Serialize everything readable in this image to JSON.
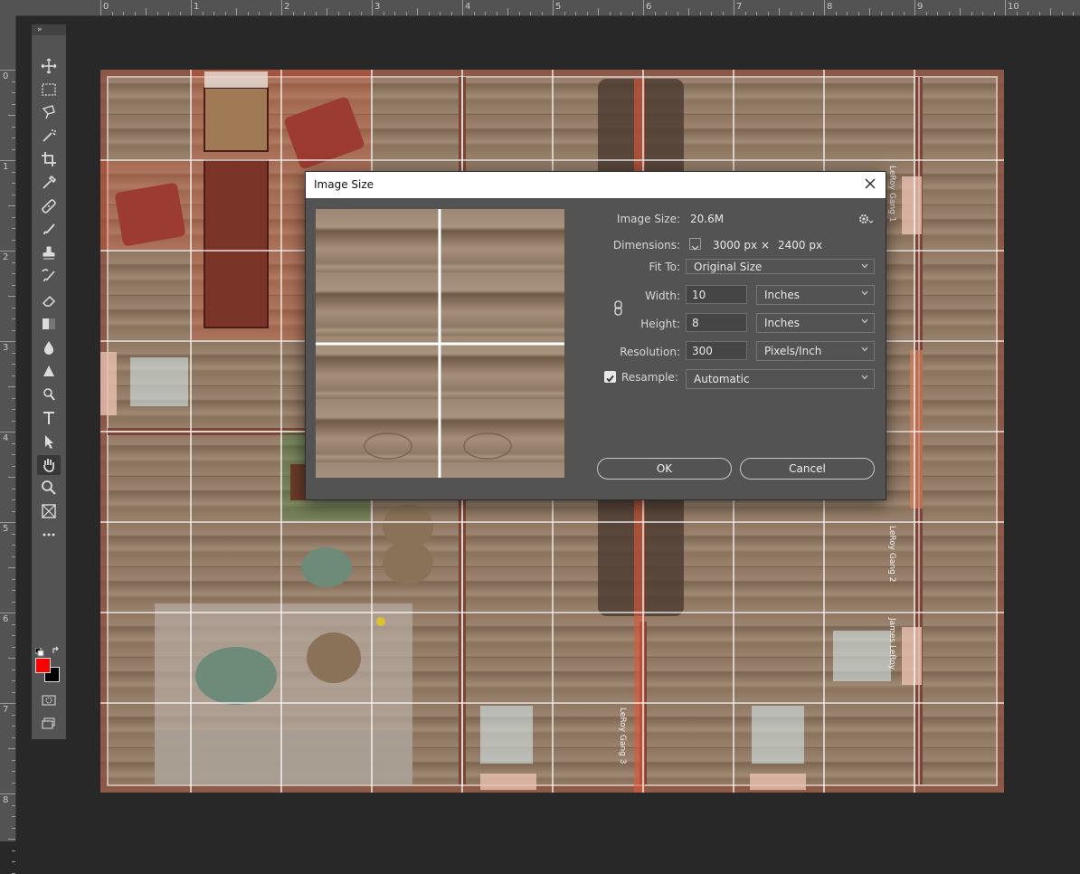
{
  "app": {
    "name": "Adobe Photoshop"
  },
  "rulers": {
    "top_labels": [
      "0",
      "1",
      "2",
      "3",
      "4",
      "5",
      "6",
      "7",
      "8",
      "9",
      "10"
    ],
    "left_labels": [
      "0",
      "1",
      "2",
      "3",
      "4",
      "5",
      "6",
      "7",
      "8"
    ]
  },
  "toolbar": {
    "grip": "»",
    "tools": [
      {
        "name": "move-tool",
        "icon": "move-icon"
      },
      {
        "name": "marquee-tool",
        "icon": "rect-marquee-icon"
      },
      {
        "name": "lasso-tool",
        "icon": "lasso-icon"
      },
      {
        "name": "magic-wand-tool",
        "icon": "magic-wand-icon"
      },
      {
        "name": "crop-tool",
        "icon": "crop-icon"
      },
      {
        "name": "eyedropper-tool",
        "icon": "eyedropper-icon"
      },
      {
        "name": "healing-brush-tool",
        "icon": "bandage-icon"
      },
      {
        "name": "brush-tool",
        "icon": "brush-icon"
      },
      {
        "name": "clone-stamp-tool",
        "icon": "stamp-icon"
      },
      {
        "name": "history-brush-tool",
        "icon": "history-brush-icon"
      },
      {
        "name": "eraser-tool",
        "icon": "eraser-icon"
      },
      {
        "name": "gradient-tool",
        "icon": "gradient-icon"
      },
      {
        "name": "blur-tool",
        "icon": "drop-icon"
      },
      {
        "name": "dodge-tool",
        "icon": "dodge-icon"
      },
      {
        "name": "pen-tool",
        "icon": "pen-icon"
      },
      {
        "name": "type-tool",
        "icon": "type-icon"
      },
      {
        "name": "path-selection-tool",
        "icon": "arrow-icon"
      },
      {
        "name": "hand-tool",
        "icon": "hand-icon"
      },
      {
        "name": "zoom-tool",
        "icon": "zoom-icon"
      },
      {
        "name": "frame-tool",
        "icon": "frame-icon"
      },
      {
        "name": "more-tools",
        "icon": "ellipsis-icon"
      }
    ],
    "foreground_color": "#ff0000",
    "background_color": "#000000"
  },
  "canvas": {
    "labels": [
      "LeRoy Gang 1",
      "LeRoy Gang 2",
      "James LeRoy",
      "LeRoy Gang 3"
    ]
  },
  "dialog": {
    "title": "Image Size",
    "image_size_label": "Image Size:",
    "image_size_value": "20.6M",
    "dimensions_label": "Dimensions:",
    "dim_width": "3000 px",
    "dim_times": "×",
    "dim_height": "2400 px",
    "fit_to_label": "Fit To:",
    "fit_to_value": "Original Size",
    "width_label": "Width:",
    "width_value": "10",
    "width_unit": "Inches",
    "height_label": "Height:",
    "height_value": "8",
    "height_unit": "Inches",
    "resolution_label": "Resolution:",
    "resolution_value": "300",
    "resolution_unit": "Pixels/Inch",
    "resample_label": "Resample:",
    "resample_checked": true,
    "resample_value": "Automatic",
    "ok_label": "OK",
    "cancel_label": "Cancel"
  }
}
